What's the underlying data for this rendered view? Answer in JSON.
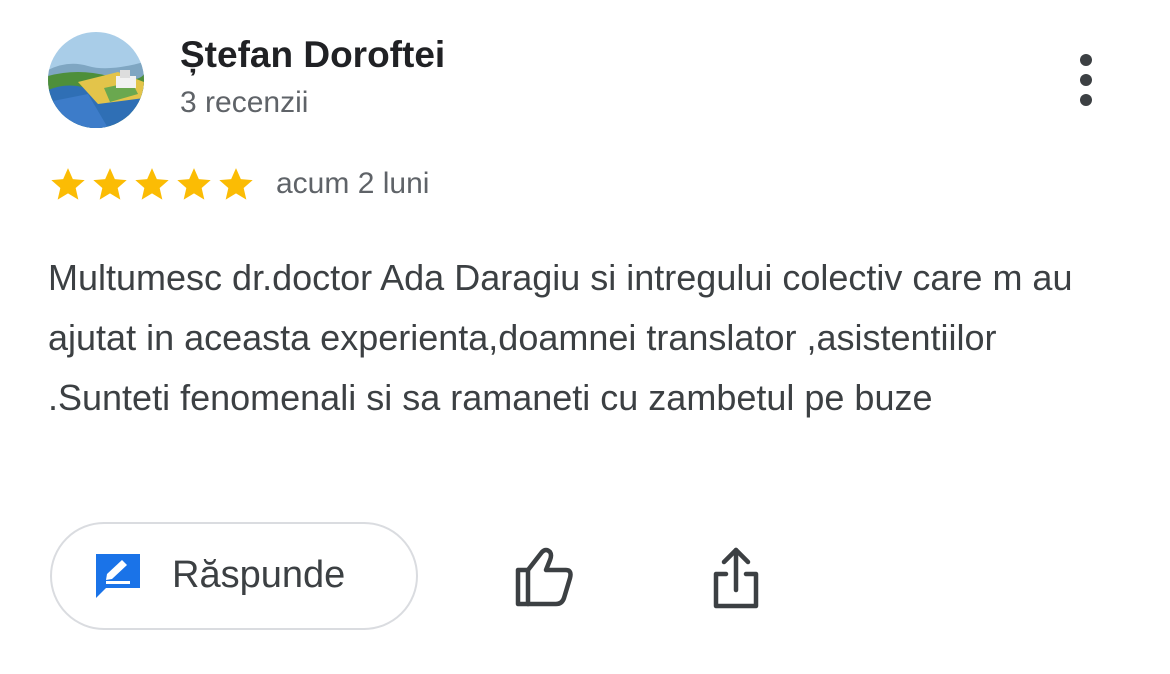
{
  "author": {
    "name": "Ștefan Doroftei",
    "review_count": "3 recenzii",
    "avatar_icon": "landscape-photo-avatar"
  },
  "review": {
    "rating": 5,
    "max_rating": 5,
    "star_color": "#fbbc04",
    "time": "acum 2 luni",
    "text": "Multumesc dr.doctor Ada Daragiu si intregului colectiv care m au ajutat in aceasta experienta,doamnei translator ,asistentiilor .Sunteti fenomenali si sa ramaneti cu zambetul pe buze"
  },
  "actions": {
    "reply_label": "Răspunde",
    "reply_icon": "reply-icon",
    "reply_icon_color": "#1a73e8",
    "like_icon": "thumbs-up-icon",
    "share_icon": "share-icon",
    "more_icon": "more-vert-icon"
  }
}
